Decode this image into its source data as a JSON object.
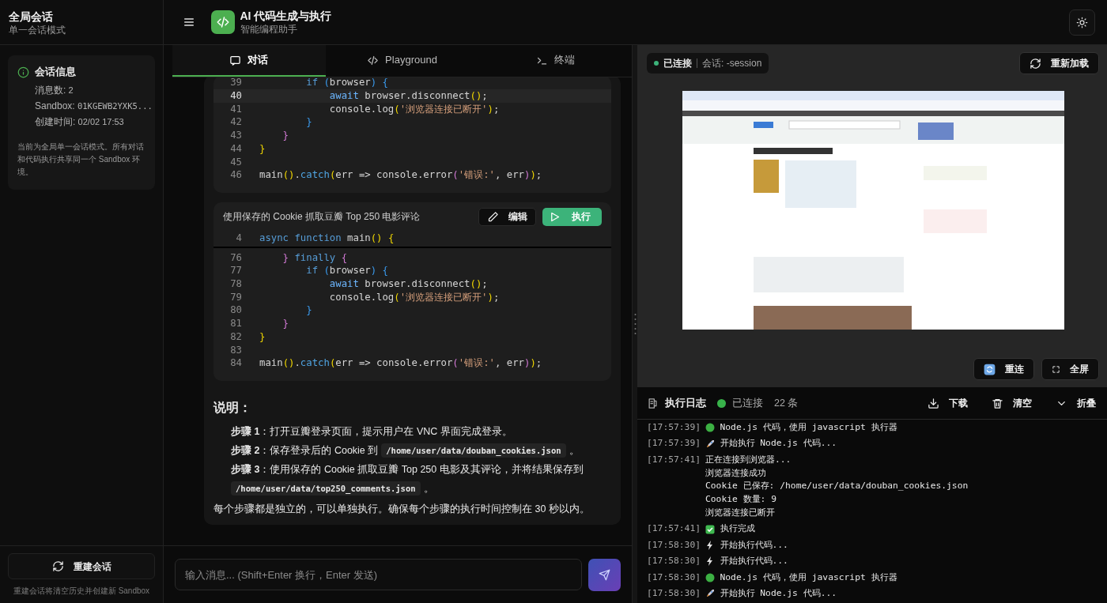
{
  "sidebar": {
    "title": "全局会话",
    "subtitle": "单一会话模式",
    "info": {
      "title": "会话信息",
      "fields": [
        {
          "label": "消息数:",
          "value": "2",
          "kind": "count"
        },
        {
          "label": "Sandbox:",
          "value": "01KGEWB2YXK5...",
          "kind": "id"
        },
        {
          "label": "创建时间:",
          "value": "02/02 17:53",
          "kind": "date"
        }
      ],
      "note": "当前为全局单一会话模式。所有对话和代码执行共享同一个 Sandbox 环境。"
    },
    "rebuild_button": "重建会话",
    "rebuild_hint": "重建会话将清空历史并创建新 Sandbox"
  },
  "header": {
    "title": "AI 代码生成与执行",
    "subtitle": "智能编程助手"
  },
  "tabs": [
    {
      "label": "对话",
      "selected": true
    },
    {
      "label": "Playground",
      "selected": false
    },
    {
      "label": "终端",
      "selected": false
    }
  ],
  "code_blocks": [
    {
      "lines": [
        {
          "number": "39",
          "active": false,
          "tokens": [
            {
              "text": "        if",
              "kind": "keyword"
            },
            {
              "text": " (",
              "kind": "brace3"
            },
            {
              "text": "browser",
              "kind": "plain"
            },
            {
              "text": ")",
              "kind": "brace3"
            },
            {
              "text": " {",
              "kind": "brace3"
            }
          ]
        },
        {
          "number": "40",
          "active": true,
          "tokens": [
            {
              "text": "            await",
              "kind": "await"
            },
            {
              "text": " browser.disconnect",
              "kind": "plain"
            },
            {
              "text": "()",
              "kind": "brace1"
            },
            {
              "text": ";",
              "kind": "plain"
            }
          ]
        },
        {
          "number": "41",
          "active": false,
          "tokens": [
            {
              "text": "            console.log",
              "kind": "plain"
            },
            {
              "text": "(",
              "kind": "brace1"
            },
            {
              "text": "'浏览器连接已断开'",
              "kind": "string"
            },
            {
              "text": ")",
              "kind": "brace1"
            },
            {
              "text": ";",
              "kind": "plain"
            }
          ]
        },
        {
          "number": "42",
          "active": false,
          "tokens": [
            {
              "text": "        }",
              "kind": "brace3"
            }
          ]
        },
        {
          "number": "43",
          "active": false,
          "tokens": [
            {
              "text": "    }",
              "kind": "brace2"
            }
          ]
        },
        {
          "number": "44",
          "active": false,
          "tokens": [
            {
              "text": "}",
              "kind": "brace1"
            }
          ]
        },
        {
          "number": "45",
          "active": false
        },
        {
          "number": "46",
          "active": false,
          "tokens": [
            {
              "text": "main",
              "kind": "plain"
            },
            {
              "text": "()",
              "kind": "brace1"
            },
            {
              "text": ".",
              "kind": "plain"
            },
            {
              "text": "catch",
              "kind": "method"
            },
            {
              "text": "(",
              "kind": "brace1"
            },
            {
              "text": "err => console.error",
              "kind": "plain"
            },
            {
              "text": "(",
              "kind": "brace2"
            },
            {
              "text": "'错误:'",
              "kind": "string"
            },
            {
              "text": ", err",
              "kind": "plain"
            },
            {
              "text": ")",
              "kind": "brace2"
            },
            {
              "text": ")",
              "kind": "brace1"
            },
            {
              "text": ";",
              "kind": "plain"
            }
          ]
        }
      ]
    },
    {
      "title": "使用保存的 Cookie 抓取豆瓣 Top 250 电影评论",
      "edit_button": "编辑",
      "run_button": "执行",
      "sticky_line": {
        "number": "4",
        "tokens": [
          {
            "text": "async",
            "kind": "keyword"
          },
          {
            "text": " function",
            "kind": "keyword"
          },
          {
            "text": " main",
            "kind": "plain"
          },
          {
            "text": "()",
            "kind": "brace1"
          },
          {
            "text": " {",
            "kind": "brace1"
          }
        ]
      },
      "lines": [
        {
          "number": "76",
          "active": false,
          "tokens": [
            {
              "text": "    }",
              "kind": "brace2"
            },
            {
              "text": " finally",
              "kind": "keyword"
            },
            {
              "text": " {",
              "kind": "brace2"
            }
          ]
        },
        {
          "number": "77",
          "active": false,
          "tokens": [
            {
              "text": "        if",
              "kind": "keyword"
            },
            {
              "text": " (",
              "kind": "brace3"
            },
            {
              "text": "browser",
              "kind": "plain"
            },
            {
              "text": ")",
              "kind": "brace3"
            },
            {
              "text": " {",
              "kind": "brace3"
            }
          ]
        },
        {
          "number": "78",
          "active": false,
          "tokens": [
            {
              "text": "            await",
              "kind": "await"
            },
            {
              "text": " browser.disconnect",
              "kind": "plain"
            },
            {
              "text": "()",
              "kind": "brace1"
            },
            {
              "text": ";",
              "kind": "plain"
            }
          ]
        },
        {
          "number": "79",
          "active": false,
          "tokens": [
            {
              "text": "            console.log",
              "kind": "plain"
            },
            {
              "text": "(",
              "kind": "brace1"
            },
            {
              "text": "'浏览器连接已断开'",
              "kind": "string"
            },
            {
              "text": ")",
              "kind": "brace1"
            },
            {
              "text": ";",
              "kind": "plain"
            }
          ]
        },
        {
          "number": "80",
          "active": false,
          "tokens": [
            {
              "text": "        }",
              "kind": "brace3"
            }
          ]
        },
        {
          "number": "81",
          "active": false,
          "tokens": [
            {
              "text": "    }",
              "kind": "brace2"
            }
          ]
        },
        {
          "number": "82",
          "active": false,
          "tokens": [
            {
              "text": "}",
              "kind": "brace1"
            }
          ]
        },
        {
          "number": "83",
          "active": false
        },
        {
          "number": "84",
          "active": false,
          "tokens": [
            {
              "text": "main",
              "kind": "plain"
            },
            {
              "text": "()",
              "kind": "brace1"
            },
            {
              "text": ".",
              "kind": "plain"
            },
            {
              "text": "catch",
              "kind": "method"
            },
            {
              "text": "(",
              "kind": "brace1"
            },
            {
              "text": "err => console.error",
              "kind": "plain"
            },
            {
              "text": "(",
              "kind": "brace2"
            },
            {
              "text": "'错误:'",
              "kind": "string"
            },
            {
              "text": ", err",
              "kind": "plain"
            },
            {
              "text": ")",
              "kind": "brace2"
            },
            {
              "text": ")",
              "kind": "brace1"
            },
            {
              "text": ";",
              "kind": "plain"
            }
          ]
        }
      ]
    }
  ],
  "explanation": {
    "heading": "说明：",
    "steps": [
      [
        {
          "kind": "text",
          "text": "**步骤 1**：打开豆瓣登录页面，提示用户在 VNC 界面完成登录。"
        }
      ],
      [
        {
          "kind": "text",
          "text": "**步骤 2**：保存登录后的 Cookie 到"
        },
        {
          "kind": "code",
          "text": "/home/user/data/douban_cookies.json"
        },
        {
          "kind": "text",
          "text": "。"
        }
      ],
      [
        {
          "kind": "text",
          "text": "**步骤 3**：使用保存的 Cookie 抓取豆瓣 Top 250 电影及其评论，并将结果保存到"
        },
        {
          "kind": "code",
          "text": "/home/user/data/top250_comments.json"
        },
        {
          "kind": "text",
          "text": "。"
        }
      ]
    ],
    "footer": "每个步骤都是独立的，可以单独执行。确保每个步骤的执行时间控制在 30 秒以内。"
  },
  "input": {
    "placeholder": "输入消息... (Shift+Enter 换行，Enter 发送)"
  },
  "vnc": {
    "connected": true,
    "status": "已连接",
    "session": "会话: -session",
    "reload_button": "重新加载",
    "reconnect_button": "重连",
    "fullscreen_button": "全屏"
  },
  "log": {
    "title": "执行日志",
    "connected": true,
    "status": "已连接",
    "count": "22 条",
    "download_button": "下载",
    "clear_button": "清空",
    "collapse_button": "折叠",
    "entries": [
      {
        "time": "[17:57:39]",
        "kind": "info",
        "lines": [
          "Node.js 代码，使用 javascript 执行器"
        ]
      },
      {
        "time": "[17:57:39]",
        "kind": "start",
        "lines": [
          "开始执行 Node.js 代码..."
        ]
      },
      {
        "time": "[17:57:41]",
        "kind": "output",
        "lines": [
          "正在连接到浏览器...",
          "浏览器连接成功",
          "Cookie 已保存: /home/user/data/douban_cookies.json",
          "Cookie 数量: 9",
          "浏览器连接已断开"
        ]
      },
      {
        "time": "[17:57:41]",
        "kind": "done",
        "lines": [
          "执行完成"
        ]
      },
      {
        "time": "[17:58:30]",
        "kind": "run",
        "lines": [
          "开始执行代码..."
        ]
      },
      {
        "time": "[17:58:30]",
        "kind": "run",
        "lines": [
          "开始执行代码..."
        ]
      },
      {
        "time": "[17:58:30]",
        "kind": "info",
        "lines": [
          "Node.js 代码，使用 javascript 执行器"
        ]
      },
      {
        "time": "[17:58:30]",
        "kind": "start",
        "lines": [
          "开始执行 Node.js 代码..."
        ]
      }
    ]
  }
}
